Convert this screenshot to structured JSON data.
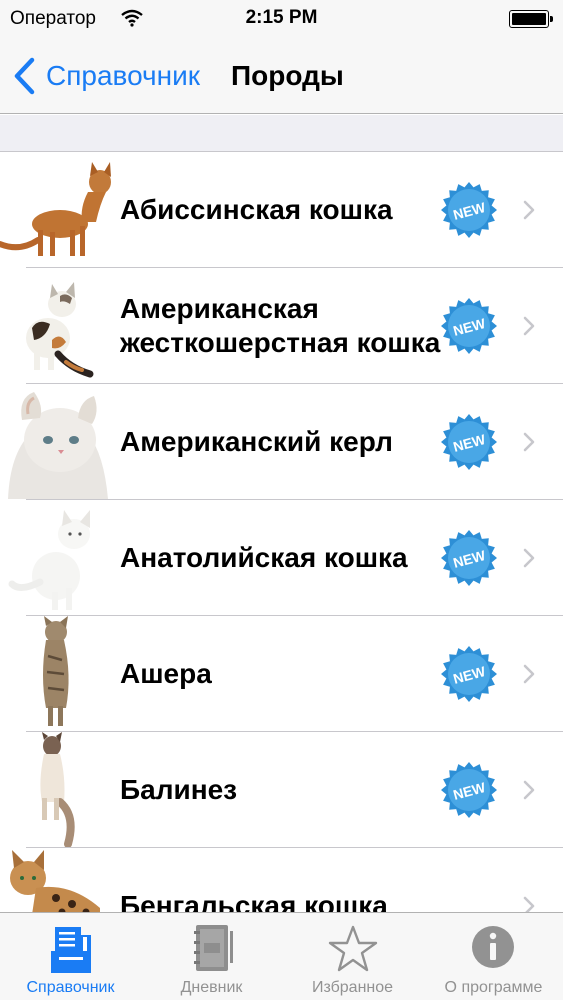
{
  "status_bar": {
    "carrier": "Оператор",
    "time": "2:15 PM"
  },
  "nav": {
    "back_label": "Справочник",
    "title": "Породы"
  },
  "rows": [
    {
      "label": "Абиссинская кошка",
      "badge": "NEW",
      "cat": "abyssinian"
    },
    {
      "label": "Американская жесткошерстная кошка",
      "badge": "NEW",
      "cat": "wirehair"
    },
    {
      "label": "Американский керл",
      "badge": "NEW",
      "cat": "curl"
    },
    {
      "label": "Анатолийская кошка",
      "badge": "NEW",
      "cat": "anatolian"
    },
    {
      "label": "Ашера",
      "badge": "NEW",
      "cat": "ashera"
    },
    {
      "label": "Балинез",
      "badge": "NEW",
      "cat": "balinese"
    },
    {
      "label": "Бенгальская кошка",
      "badge": "",
      "cat": "bengal"
    }
  ],
  "tabs": [
    {
      "label": "Справочник",
      "icon": "book-icon",
      "active": true
    },
    {
      "label": "Дневник",
      "icon": "notebook-icon",
      "active": false
    },
    {
      "label": "Избранное",
      "icon": "star-icon",
      "active": false
    },
    {
      "label": "О программе",
      "icon": "info-icon",
      "active": false
    }
  ],
  "colors": {
    "accent": "#1a7cf4",
    "badge": "#2d8fd6",
    "inactive": "#929292"
  }
}
